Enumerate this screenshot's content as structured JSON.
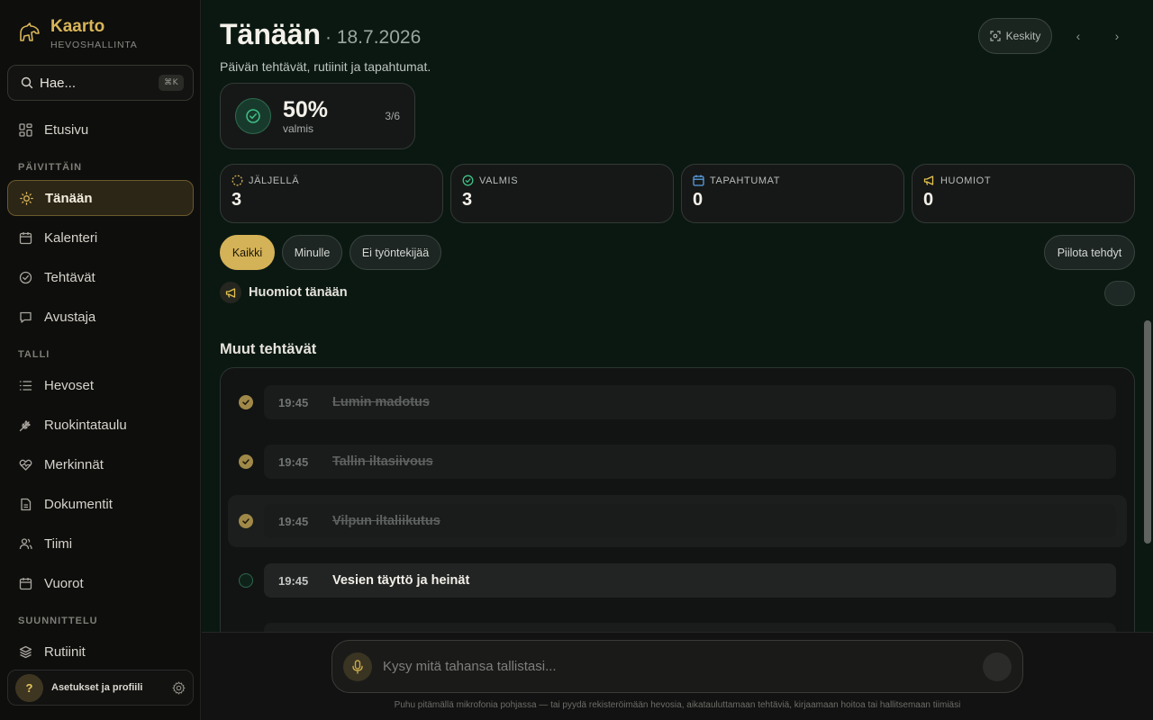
{
  "brand": {
    "name": "Kaarto",
    "subtitle": "HEVOSHALLINTA"
  },
  "search": {
    "label": "Hae...",
    "shortcut": "⌘K"
  },
  "nav": {
    "home": "Etusivu",
    "section_daily": "PÄIVITTÄIN",
    "today": "Tänään",
    "calendar": "Kalenteri",
    "tasks": "Tehtävät",
    "assistant": "Avustaja",
    "section_stable": "TALLI",
    "horses": "Hevoset",
    "feeding": "Ruokintataulu",
    "records": "Merkinnät",
    "documents": "Dokumentit",
    "team": "Tiimi",
    "shifts": "Vuorot",
    "section_planning": "SUUNNITTELU",
    "routines": "Rutiinit"
  },
  "settings": {
    "avatar": "?",
    "label": "Asetukset ja profiili"
  },
  "header": {
    "title": "Tänään",
    "date": "· 18.7.2026",
    "subtitle": "Päivän tehtävät, rutiinit ja tapahtumat.",
    "focus_button": "Keskity",
    "prev": "‹",
    "next": "›"
  },
  "progress": {
    "percent_label": "50%",
    "percent": 50,
    "label": "valmis",
    "count": "3/6"
  },
  "stats": [
    {
      "label": "JÄLJELLÄ",
      "value": "3",
      "icon": "dashed-circle-icon",
      "color": "#d4b257"
    },
    {
      "label": "VALMIS",
      "value": "3",
      "icon": "check-circle-icon",
      "color": "#3fbf86"
    },
    {
      "label": "TAPAHTUMAT",
      "value": "0",
      "icon": "calendar-icon",
      "color": "#5b9fe0"
    },
    {
      "label": "HUOMIOT",
      "value": "0",
      "icon": "megaphone-icon",
      "color": "#e2c14f"
    }
  ],
  "filters": {
    "all": "Kaikki",
    "mine": "Minulle",
    "unassigned": "Ei työntekijää",
    "hide_done": "Piilota tehdyt"
  },
  "notices": {
    "label": "Huomiot tänään"
  },
  "tasks_section": {
    "title": "Muut tehtävät",
    "tasks": [
      {
        "time": "19:45",
        "name": "Lumin madotus",
        "done": true
      },
      {
        "time": "19:45",
        "name": "Tallin iltasiivous",
        "done": true
      },
      {
        "time": "19:45",
        "name": "Vilpun iltaliikutus",
        "done": true
      },
      {
        "time": "19:45",
        "name": "Vesien täyttö ja heinät",
        "done": false
      }
    ]
  },
  "assistant_bar": {
    "placeholder": "Kysy mitä tahansa tallistasi...",
    "hint": "Puhu pitämällä mikrofonia pohjassa — tai pyydä rekisteröimään hevosia, aikatauluttamaan tehtäviä, kirjaamaan hoitoa tai hallitsemaan tiimiäsi"
  }
}
